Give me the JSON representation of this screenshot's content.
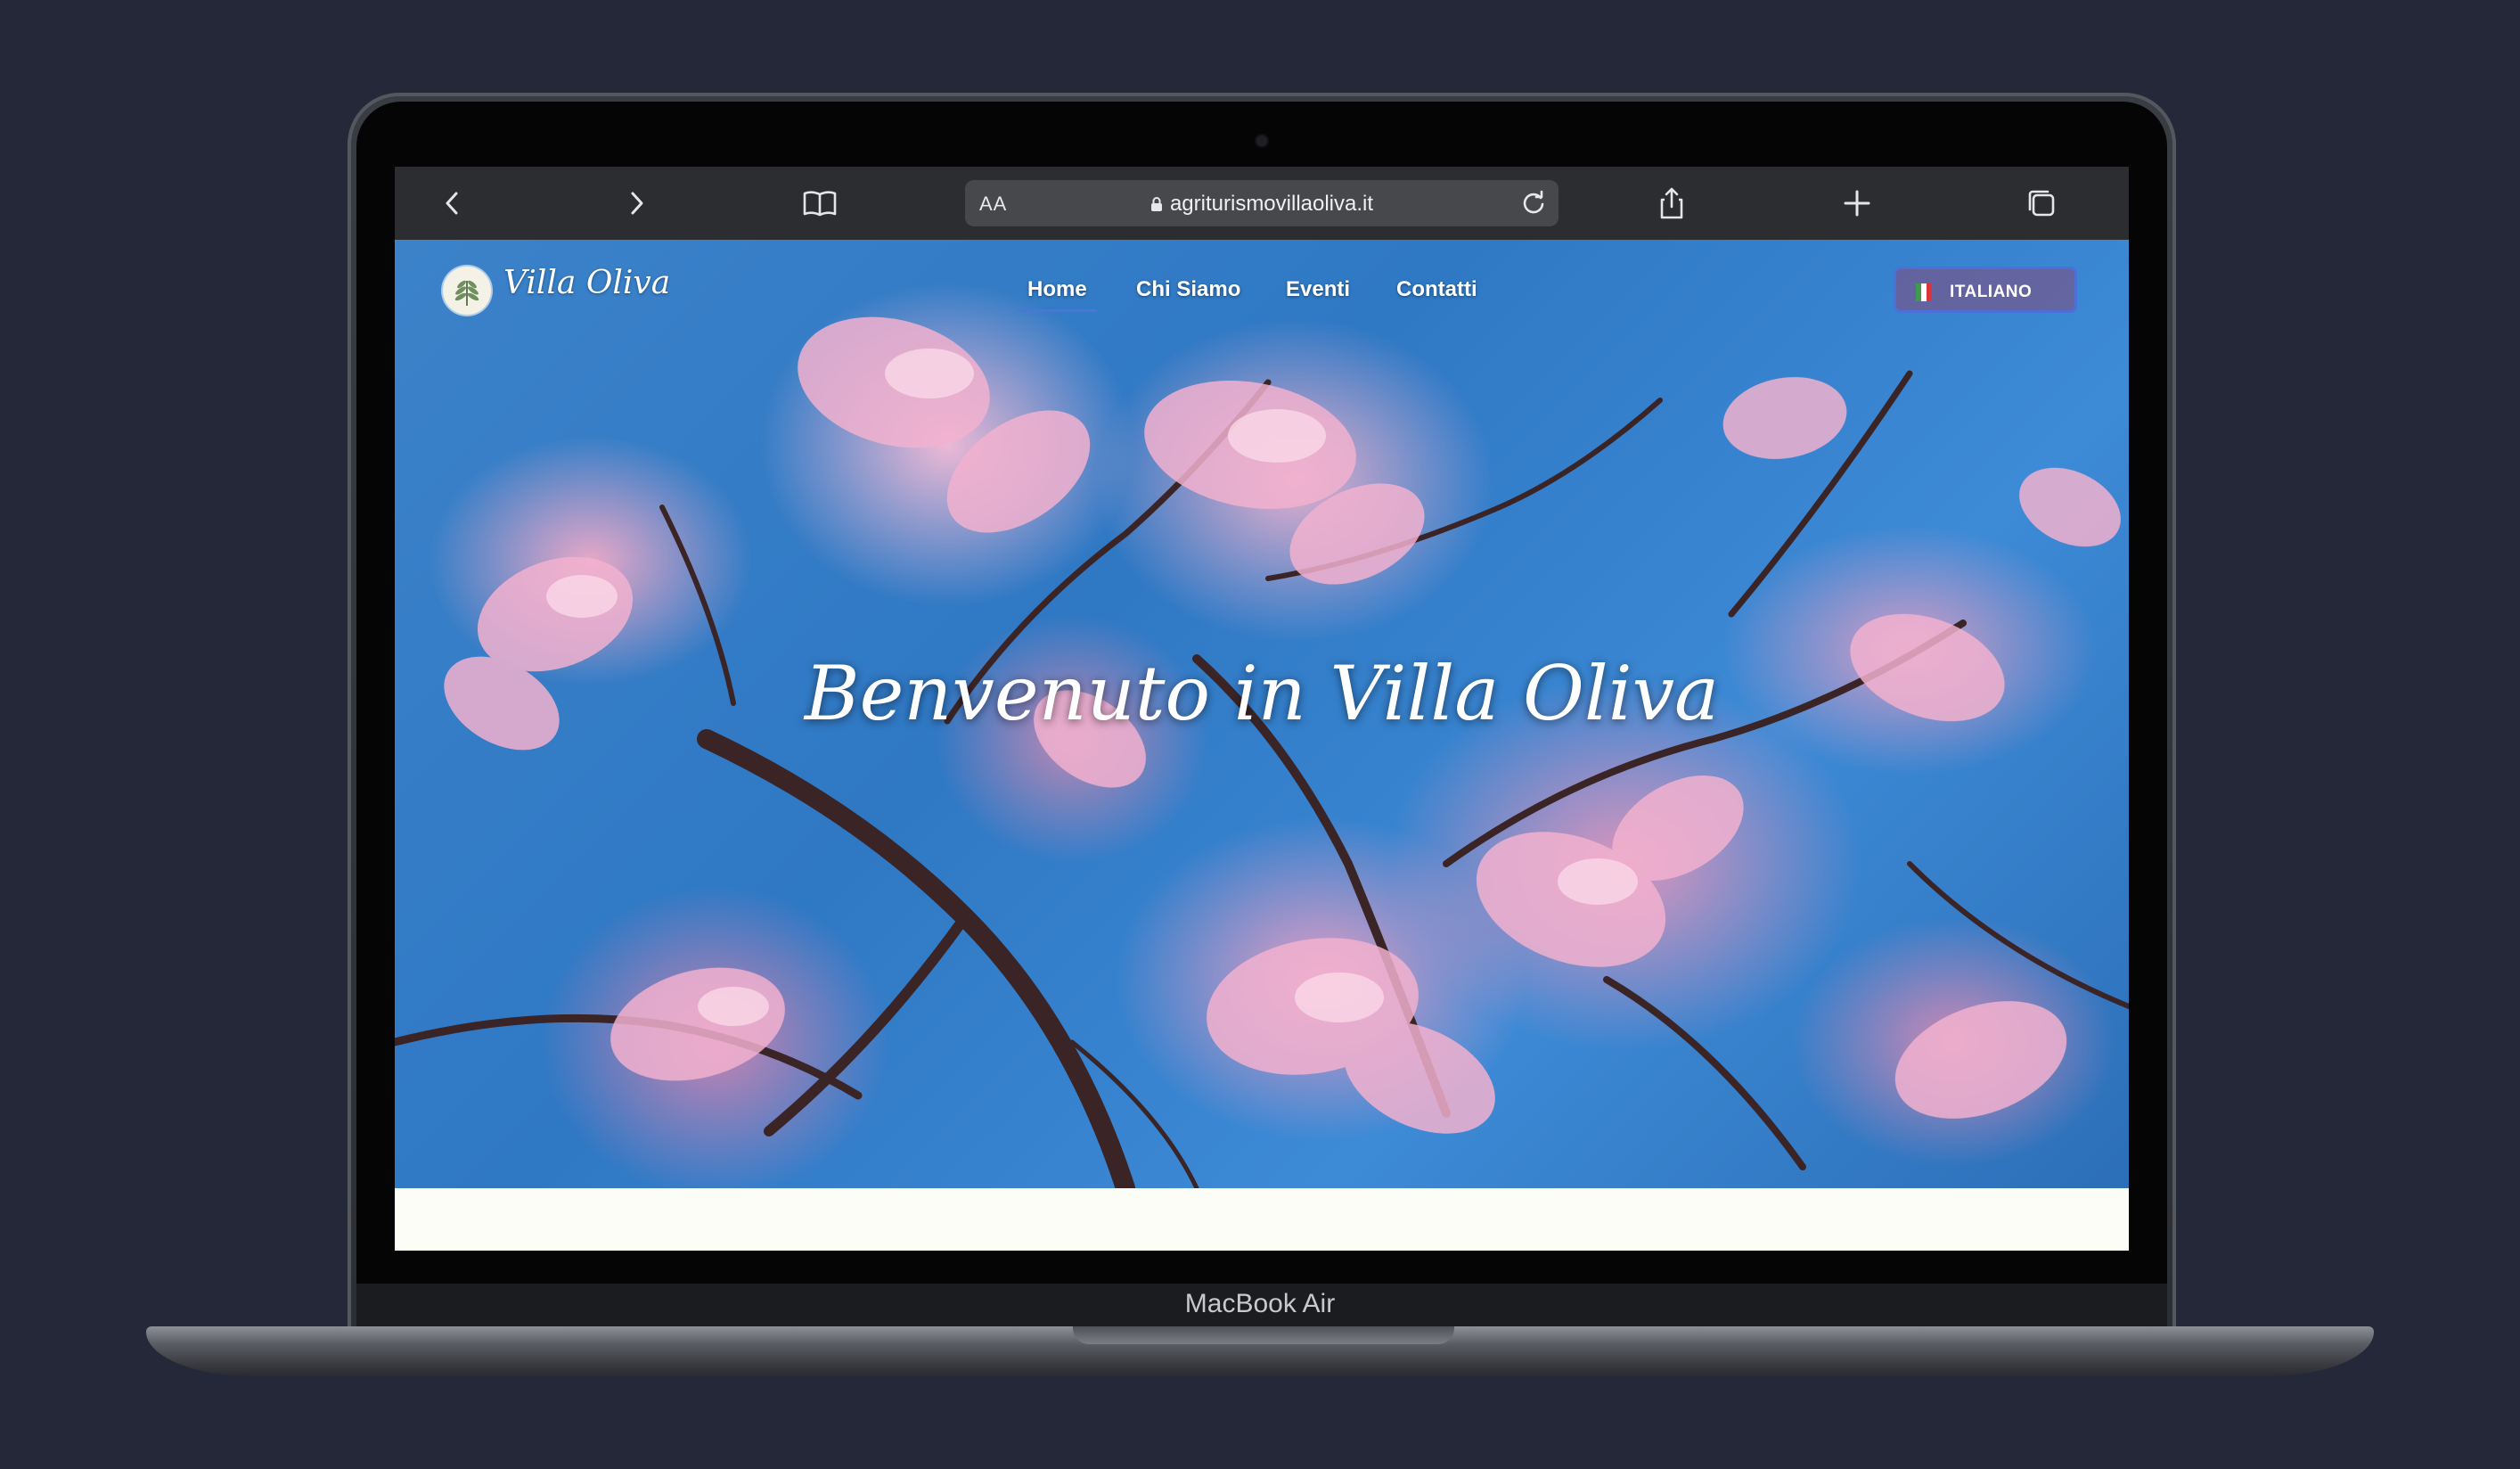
{
  "browser": {
    "text_size_label": "AA",
    "url": "agriturismovillaoliva.it",
    "icons": [
      "back-arrow-icon",
      "forward-arrow-icon",
      "bookmarks-book-icon",
      "lock-icon",
      "reload-icon",
      "share-icon",
      "new-tab-plus-icon",
      "tabs-overview-icon"
    ]
  },
  "site": {
    "name": "Villa Oliva",
    "nav": [
      {
        "label": "Home",
        "active": true
      },
      {
        "label": "Chi Siamo"
      },
      {
        "label": "Eventi"
      },
      {
        "label": "Contatti"
      }
    ],
    "language_button": "ITALIANO",
    "hero_title": "Benvenuto in Villa Oliva"
  },
  "device": {
    "model_label": "MacBook Air"
  },
  "colors": {
    "page_background": "#252838",
    "toolbar": "#2c2d31",
    "accent_blue": "#4f74d9",
    "sky": "#3b82c9",
    "blossom_pink": "#f0aac8",
    "page_below_hero": "#fdfdf7"
  }
}
